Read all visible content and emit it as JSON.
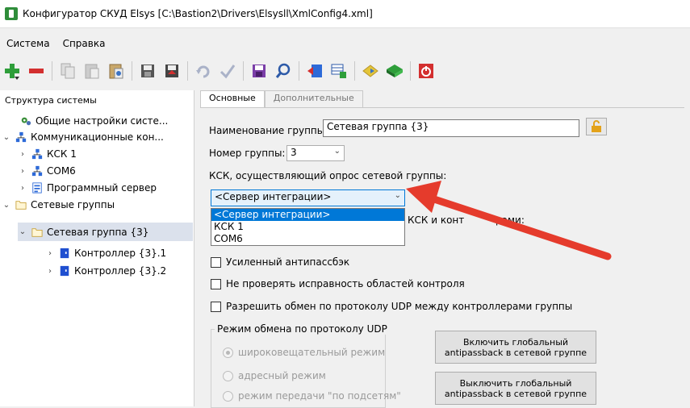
{
  "window": {
    "title": "Конфигуратор СКУД Elsys [C:\\Bastion2\\Drivers\\Elsysll\\XmlConfig4.xml]"
  },
  "menu": {
    "items": [
      "Система",
      "Справка"
    ]
  },
  "toolbar": {
    "icons": [
      "add-icon",
      "remove-icon",
      "copy-icon",
      "paste-icon",
      "paste-special-icon",
      "save-config-icon",
      "export-icon",
      "undo-icon",
      "apply-icon",
      "save-icon",
      "search-icon",
      "import-icon",
      "grid-icon",
      "diamond-icon",
      "book-icon",
      "power-icon"
    ]
  },
  "left_panel": {
    "header": "Структура системы",
    "tree": [
      {
        "label": "Общие настройки систе...",
        "icon": "settings-icon"
      },
      {
        "label": "Коммуникационные кон...",
        "icon": "network-icon"
      },
      {
        "label": "КСК 1",
        "icon": "network-icon"
      },
      {
        "label": "COM6",
        "icon": "network-icon"
      },
      {
        "label": "Программный сервер",
        "icon": "server-icon"
      },
      {
        "label": "Сетевые группы",
        "icon": "folder-icon"
      },
      {
        "label": "Сетевая группа {3}",
        "icon": "folder-icon"
      },
      {
        "label": "Контроллер {3}.1",
        "icon": "controller-icon"
      },
      {
        "label": "Контроллер {3}.2",
        "icon": "controller-icon"
      }
    ]
  },
  "tabs": {
    "main": "Основные",
    "extra": "Дополнительные"
  },
  "form": {
    "group_name_label": "Наименование группы:",
    "group_name_value": "Сетевая группа {3}",
    "group_number_label": "Номер группы:",
    "group_number_value": "3",
    "ksk_label": "КСК, осуществляющий опрос сетевой группы:",
    "ksk_value": "<Сервер интеграции>",
    "ksk_options": [
      "<Сервер интеграции>",
      "КСК 1",
      "COM6"
    ],
    "hidden_label_fragment_1": "КСК и конт",
    "hidden_label_fragment_2": "рами:",
    "enhanced_antipassback": "Усиленный антипассбэк",
    "no_check_areas": "Не проверять исправность областей контроля",
    "allow_udp": "Разрешить обмен по протоколу UDP между контроллерами группы",
    "udp_mode_title": "Режим обмена по протоколу UDP",
    "udp_broadcast": "широковещательный режим",
    "udp_address": "адресный режим",
    "udp_subnets": "режим передачи \"по подсетям\"",
    "enable_global_ap": "Включить глобальный antipassback в сетевой группе",
    "disable_global_ap": "Выключить глобальный antipassback в сетевой группе"
  },
  "colors": {
    "selection": "#0078d7",
    "arrow": "#e53b2c",
    "tree_selected": "#dbe1ec"
  }
}
